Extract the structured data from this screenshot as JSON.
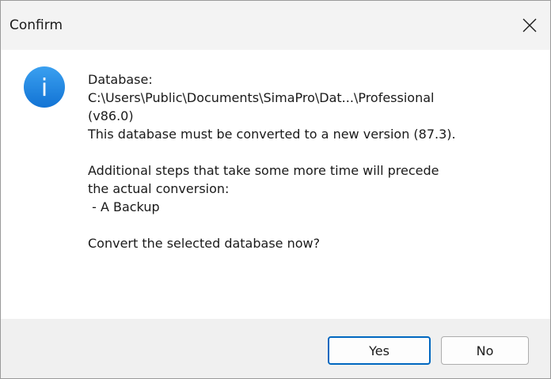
{
  "window": {
    "title": "Confirm"
  },
  "icon": {
    "name": "info-icon",
    "glyph": "i",
    "color": "#1e88e5"
  },
  "message": {
    "lines": [
      "Database:",
      "C:\\Users\\Public\\Documents\\SimaPro\\Dat...\\Professional",
      "(v86.0)",
      "This database must be converted to a new version (87.3).",
      "",
      "Additional steps that take some more time will precede",
      "the actual conversion:",
      " - A Backup",
      "",
      "Convert the selected database now?"
    ]
  },
  "buttons": {
    "yes_label": "Yes",
    "no_label": "No"
  }
}
